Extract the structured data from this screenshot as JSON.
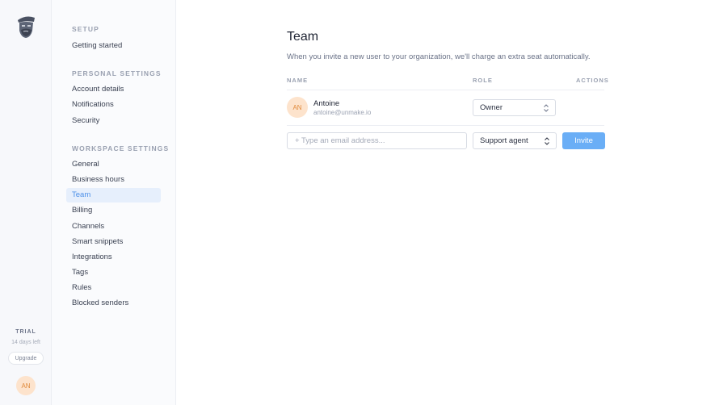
{
  "app": {
    "logo": "captain-logo-icon",
    "colors": {
      "accent": "#6aaef6",
      "active_nav_bg": "#e6effc",
      "active_nav_text": "#4d90e8",
      "avatar_bg": "#fde3cc",
      "avatar_text": "#e08a3c"
    }
  },
  "rail": {
    "trial_label": "TRIAL",
    "trial_days": "14 days left",
    "upgrade_label": "Upgrade",
    "user_initials": "AN"
  },
  "sidebar": {
    "sections": [
      {
        "title": "SETUP",
        "items": [
          {
            "label": "Getting started"
          }
        ]
      },
      {
        "title": "PERSONAL SETTINGS",
        "items": [
          {
            "label": "Account details"
          },
          {
            "label": "Notifications"
          },
          {
            "label": "Security"
          }
        ]
      },
      {
        "title": "WORKSPACE SETTINGS",
        "items": [
          {
            "label": "General"
          },
          {
            "label": "Business hours"
          },
          {
            "label": "Team",
            "active": true
          },
          {
            "label": "Billing"
          },
          {
            "label": "Channels"
          },
          {
            "label": "Smart snippets"
          },
          {
            "label": "Integrations"
          },
          {
            "label": "Tags"
          },
          {
            "label": "Rules"
          },
          {
            "label": "Blocked senders"
          }
        ]
      }
    ]
  },
  "main": {
    "title": "Team",
    "subtitle": "When you invite a new user to your organization, we'll charge an extra seat automatically.",
    "columns": {
      "name": "NAME",
      "role": "ROLE",
      "actions": "ACTIONS"
    },
    "members": [
      {
        "initials": "AN",
        "name": "Antoine",
        "email": "antoine@unmake.io",
        "role": "Owner"
      }
    ],
    "invite": {
      "placeholder": "+ Type an email address...",
      "value": "",
      "role": "Support agent",
      "button_label": "Invite"
    }
  }
}
